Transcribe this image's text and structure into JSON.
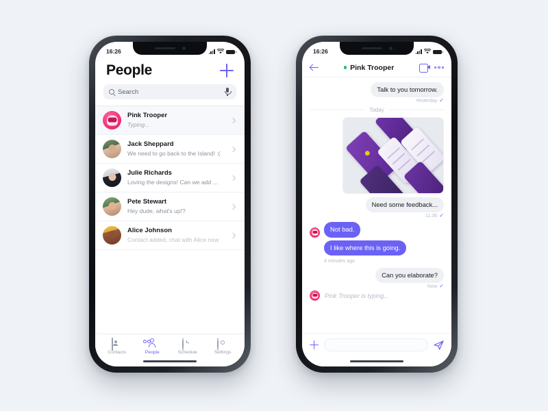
{
  "theme": {
    "page_bg": "#eff2f6",
    "accent": "#6b62f5",
    "online": "#25c16f",
    "bubble_in": "#6b62f5",
    "bubble_out": "#eef0f4",
    "muted_text": "#8b929e"
  },
  "status_bar": {
    "time": "16:26",
    "signal_icon": "signal-bars-icon",
    "wifi_icon": "wifi-icon",
    "battery_icon": "battery-icon"
  },
  "people_screen": {
    "title": "People",
    "add_icon": "plus-icon",
    "search": {
      "placeholder": "Search",
      "icon": "search-icon",
      "mic_icon": "microphone-icon",
      "value": ""
    },
    "contacts": [
      {
        "name": "Pink Trooper",
        "preview": "Typing...",
        "style": "typing",
        "avatar": "trooper",
        "chevron": "chevron-right-icon"
      },
      {
        "name": "Jack Sheppard",
        "preview": "We need to go back to the Island! :(",
        "style": "normal",
        "avatar": "av-a",
        "chevron": "chevron-right-icon"
      },
      {
        "name": "Julie Richards",
        "preview": "Loving the designs! Can we add ...",
        "style": "normal",
        "avatar": "av-b",
        "chevron": "chevron-right-icon"
      },
      {
        "name": "Pete Stewart",
        "preview": "Hey dude, what's up!?",
        "style": "normal",
        "avatar": "av-c",
        "chevron": "chevron-right-icon"
      },
      {
        "name": "Alice Johnson",
        "preview": "Contact added, chat with Alice now",
        "style": "muted",
        "avatar": "av-d",
        "chevron": "chevron-right-icon"
      }
    ],
    "tabs": [
      {
        "label": "Contacts",
        "icon": "contacts-icon",
        "active": false
      },
      {
        "label": "People",
        "icon": "people-icon",
        "active": true
      },
      {
        "label": "Schedule",
        "icon": "alarm-clock-icon",
        "active": false
      },
      {
        "label": "Settings",
        "icon": "gear-icon",
        "active": false
      }
    ]
  },
  "chat_screen": {
    "back_icon": "back-arrow-icon",
    "online_dot": "online-status-dot",
    "title": "Pink Trooper",
    "video_icon": "video-camera-icon",
    "more_icon": "more-options-icon",
    "messages": [
      {
        "kind": "bubble",
        "side": "out",
        "text": "Talk to you tomorrow."
      },
      {
        "kind": "meta",
        "side": "out",
        "text": "Yesterday",
        "tick": "✓"
      },
      {
        "kind": "day",
        "text": "Today"
      },
      {
        "kind": "image",
        "side": "out",
        "alt": "app-screens-mockup-image"
      },
      {
        "kind": "bubble",
        "side": "out",
        "text": "Need some feedback..."
      },
      {
        "kind": "meta",
        "side": "out",
        "text": "11:35",
        "tick": "✓"
      },
      {
        "kind": "bubble",
        "side": "in",
        "text": "Not bad.",
        "avatar": true
      },
      {
        "kind": "bubble",
        "side": "in",
        "text": "I like where this is going."
      },
      {
        "kind": "meta",
        "side": "left",
        "text": "4 minutes ago",
        "tick": ""
      },
      {
        "kind": "bubble",
        "side": "out",
        "text": "Can you elaborate?"
      },
      {
        "kind": "meta",
        "side": "out",
        "text": "Now",
        "tick": "✓"
      },
      {
        "kind": "typing",
        "text": "Pink Trooper is typing..."
      }
    ],
    "composer": {
      "attach_icon": "plus-icon",
      "input_value": "",
      "input_placeholder": "",
      "send_icon": "send-paper-plane-icon"
    }
  }
}
